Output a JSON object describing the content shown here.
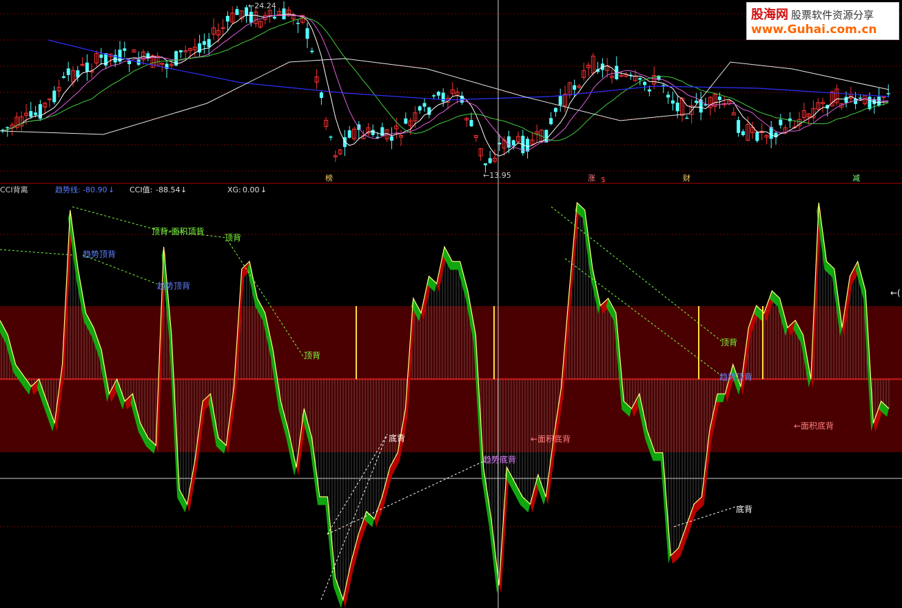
{
  "header": {
    "indicator_name": "CCI背离",
    "trend_label": "趋势线:",
    "trend_value": "-80.90",
    "cci_label": "CCI值:",
    "cci_value": "-88.54",
    "xg_label": "XG:",
    "xg_value": "0.00",
    "arrow": "↓"
  },
  "price_pane": {
    "high_label": "←24.24",
    "low_label": "←13.95",
    "event_markers": [
      "榜",
      "涨",
      "$",
      "财",
      "减"
    ]
  },
  "cci_pane": {
    "annotations": [
      "趋势顶背",
      "顶背-面积顶背",
      "顶背",
      "趋势顶背",
      "顶背",
      "底背",
      "趋势底背",
      "←面积底背",
      "顶背",
      "趋势顶背",
      "底背",
      "←面积底背"
    ],
    "right_edge_label": "←("
  },
  "watermark": {
    "line1_brand": "股海网",
    "line1_text": "股票软件资源分享",
    "line2": "www.Guhai.com.cn"
  },
  "colors": {
    "background": "#000000",
    "up_candle": "#ff3333",
    "down_candle": "#54ffff",
    "ma_white": "#ffffff",
    "ma_magenta": "#e060e0",
    "ma_green": "#40d040",
    "ma_blue": "#3030ff",
    "ma_light": "#e8e8e8",
    "cci_line": "#ffff80",
    "cci_up_fill": "#c00000",
    "cci_down_fill": "#10b010",
    "band": "#5a0000",
    "crosshair": "#ffffff"
  },
  "chart_data": [
    {
      "type": "candlestick",
      "title": "",
      "annotations": [
        "←24.24",
        "←13.95"
      ],
      "high": 24.24,
      "low": 13.95,
      "series": [
        {
          "type": "moving_average",
          "color": "white"
        },
        {
          "type": "moving_average",
          "color": "magenta"
        },
        {
          "type": "moving_average",
          "color": "green"
        },
        {
          "type": "moving_average",
          "color": "blue"
        },
        {
          "type": "moving_average",
          "color": "light gray"
        }
      ]
    },
    {
      "type": "line",
      "title": "CCI背离",
      "series": [
        {
          "name": "CCI值",
          "last_value": -88.54,
          "values": [
            80,
            60,
            20,
            5,
            -10,
            0,
            -30,
            -60,
            20,
            230,
            150,
            90,
            70,
            40,
            -20,
            0,
            -30,
            -20,
            -60,
            -80,
            -90,
            180,
            60,
            -150,
            -170,
            -110,
            -30,
            -20,
            -80,
            -90,
            -10,
            150,
            160,
            110,
            90,
            40,
            -30,
            -70,
            -120,
            -40,
            -80,
            -160,
            -160,
            -270,
            -300,
            -250,
            -210,
            -180,
            -190,
            -160,
            -120,
            -100,
            -40,
            110,
            90,
            140,
            130,
            180,
            160,
            160,
            120,
            60,
            -120,
            -190,
            -280,
            -120,
            -140,
            -160,
            -170,
            -130,
            -160,
            -80,
            -10,
            120,
            240,
            230,
            150,
            100,
            110,
            90,
            -30,
            -40,
            -20,
            -70,
            -100,
            -100,
            -240,
            -230,
            -200,
            -170,
            -160,
            -70,
            -20,
            -20,
            20,
            -10,
            70,
            100,
            90,
            120,
            110,
            70,
            80,
            60,
            0,
            240,
            160,
            150,
            70,
            140,
            160,
            120,
            -60,
            -30,
            -40
          ],
          "last_value_trend": -80.9
        }
      ]
    }
  ]
}
